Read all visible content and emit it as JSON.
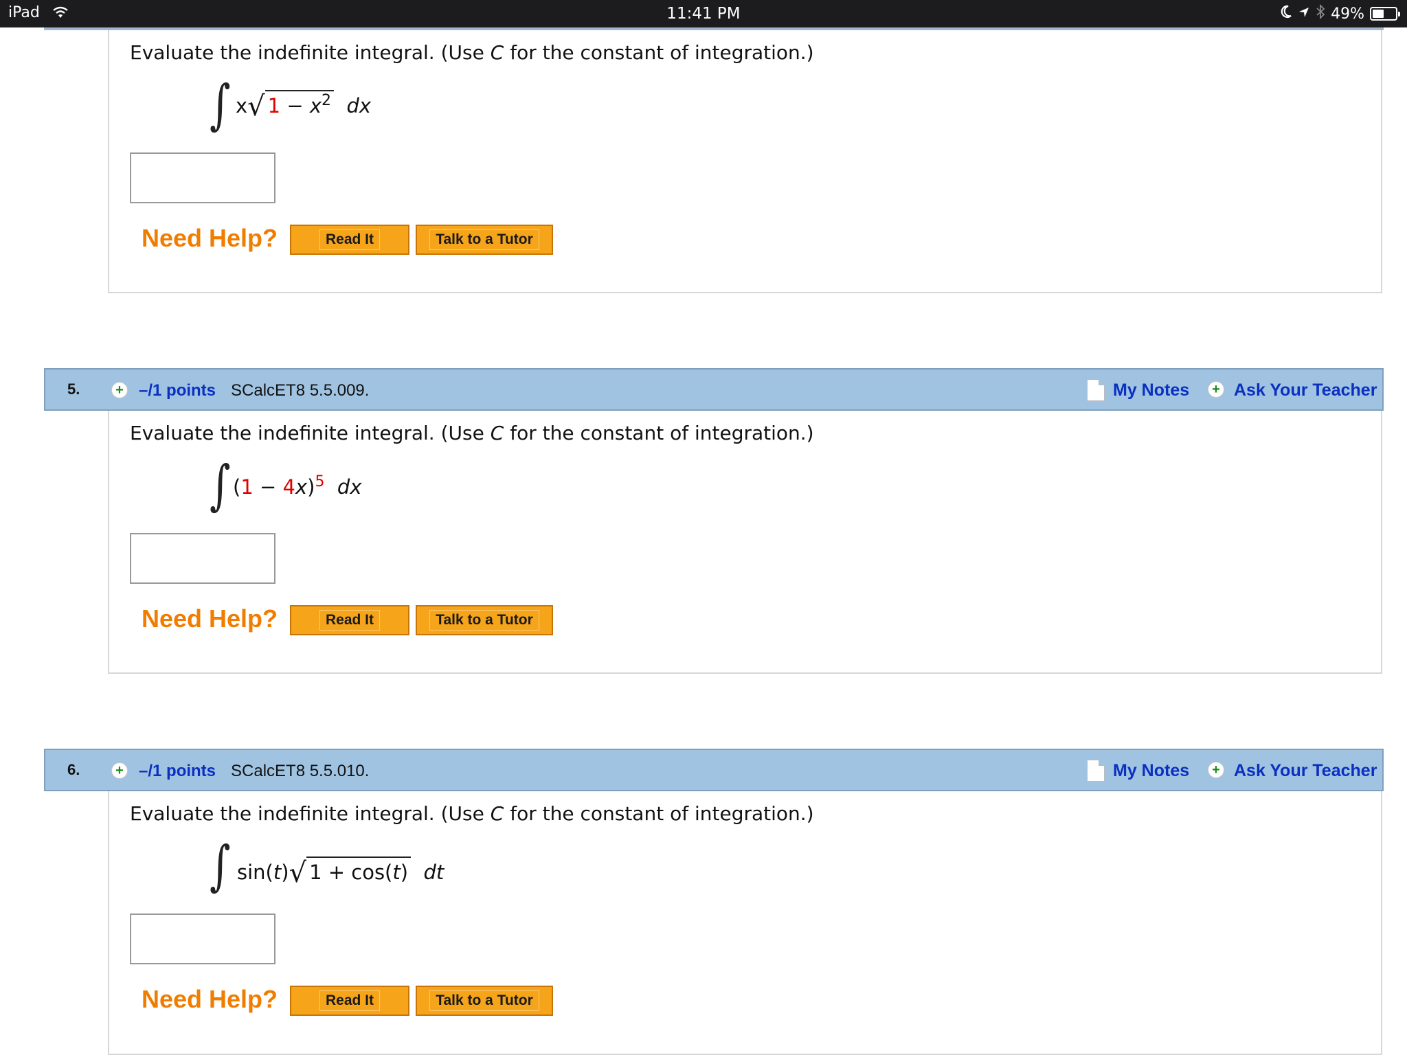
{
  "status_bar": {
    "device": "iPad",
    "time": "11:41 PM",
    "battery": "49%",
    "battery_level": 0.49
  },
  "common": {
    "prompt_pre": "Evaluate the indefinite integral. (Use ",
    "prompt_var": "C",
    "prompt_post": " for the constant of integration.)",
    "need_help": "Need Help?",
    "read_it": "Read It",
    "talk_to_tutor": "Talk to a Tutor",
    "my_notes": "My Notes",
    "ask_teacher": "Ask Your Teacher"
  },
  "q4": {
    "expr": {
      "x": "x",
      "one": "1",
      "minus": " − ",
      "xsq": "x",
      "exp": "2",
      "dx": "dx"
    }
  },
  "q5": {
    "number": "5.",
    "points": "–/1 points",
    "id": "SCalcET8 5.5.009.",
    "expr": {
      "open": "(",
      "one": "1",
      "minus": " − ",
      "four": "4",
      "x": "x",
      "close": ")",
      "exp": "5",
      "dx": "dx"
    }
  },
  "q6": {
    "number": "6.",
    "points": "–/1 points",
    "id": "SCalcET8 5.5.010.",
    "expr": {
      "sin": "sin(",
      "t1": "t",
      "close1": ")",
      "radicand_pre": "1 + cos(",
      "t2": "t",
      "close2": ")",
      "dt": "dt"
    }
  }
}
